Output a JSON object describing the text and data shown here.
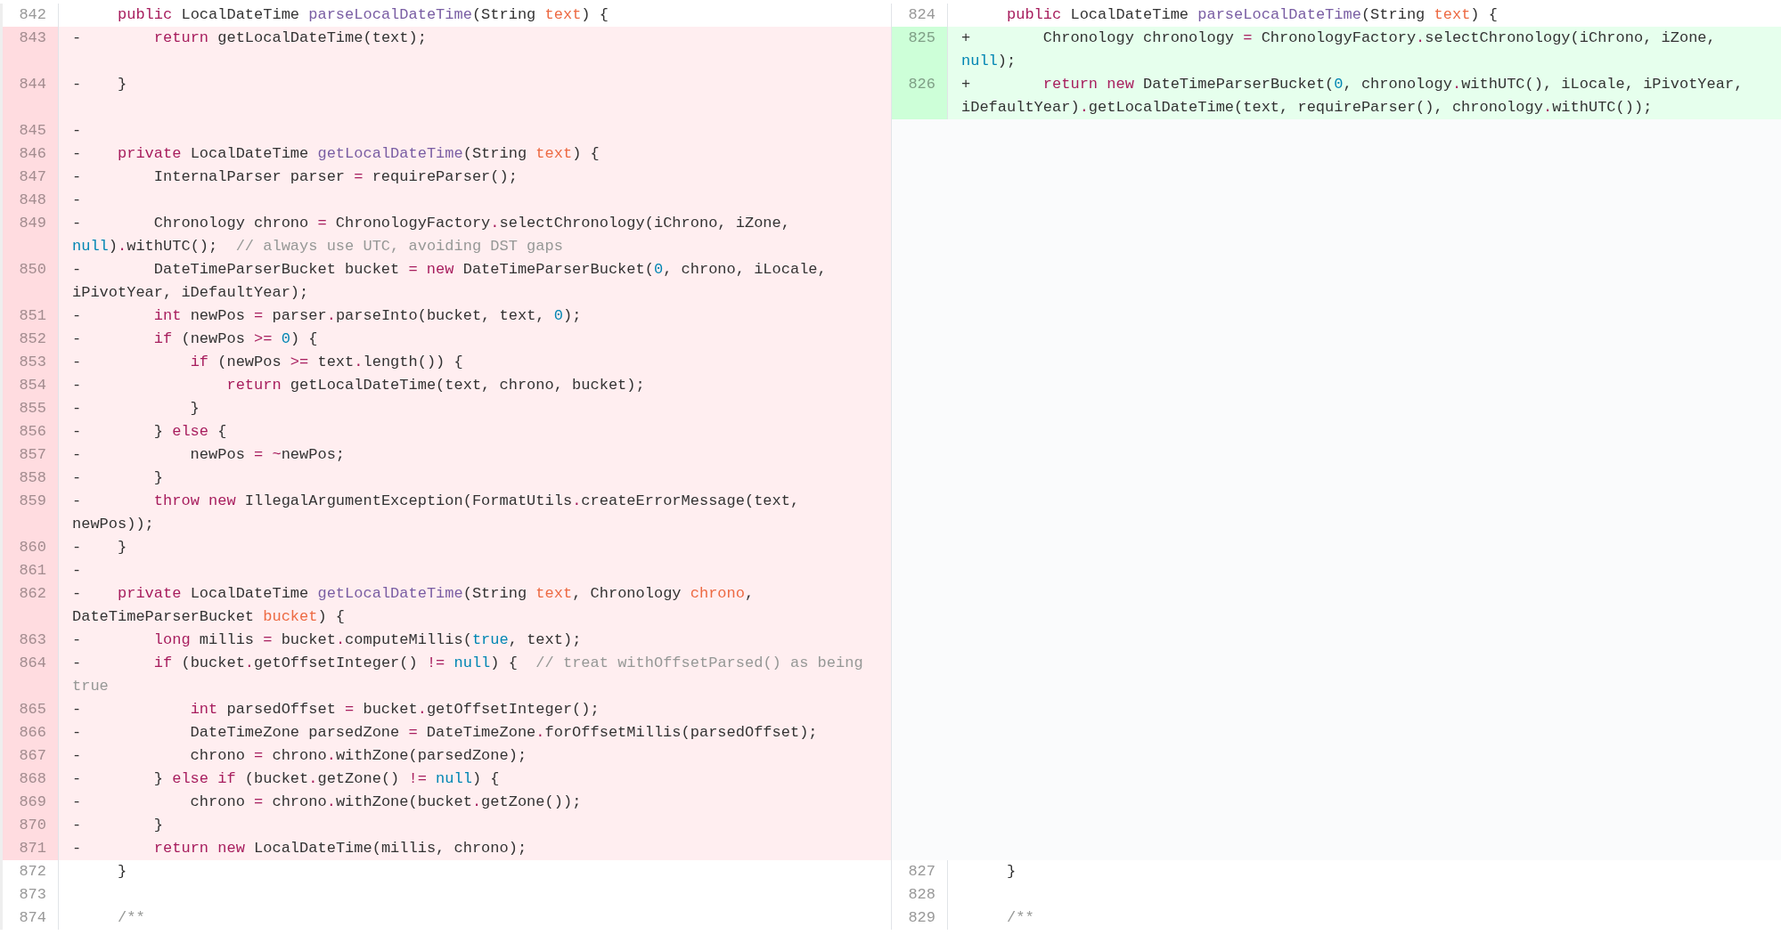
{
  "diff": {
    "rows": [
      {
        "left": {
          "kind": "context",
          "number": "842",
          "segments": [
            {
              "text": "     public",
              "kind": "keyword"
            },
            {
              "text": " LocalDateTime ",
              "kind": "plain"
            },
            {
              "text": "parseLocalDateTime",
              "kind": "function"
            },
            {
              "text": "(String ",
              "kind": "plain"
            },
            {
              "text": "text",
              "kind": "param"
            },
            {
              "text": ") {",
              "kind": "plain"
            }
          ]
        },
        "right": {
          "kind": "context",
          "number": "824",
          "segments": [
            {
              "text": "     public",
              "kind": "keyword"
            },
            {
              "text": " LocalDateTime ",
              "kind": "plain"
            },
            {
              "text": "parseLocalDateTime",
              "kind": "function"
            },
            {
              "text": "(String ",
              "kind": "plain"
            },
            {
              "text": "text",
              "kind": "param"
            },
            {
              "text": ") {",
              "kind": "plain"
            }
          ]
        }
      },
      {
        "left": {
          "kind": "deleted",
          "number": "843",
          "segments": [
            {
              "text": "-        ",
              "kind": "plain"
            },
            {
              "text": "return",
              "kind": "keyword"
            },
            {
              "text": " getLocalDateTime(text);",
              "kind": "plain"
            }
          ]
        },
        "right": {
          "kind": "added",
          "number": "825",
          "segments": [
            {
              "text": "+        Chronology chronology ",
              "kind": "plain"
            },
            {
              "text": "=",
              "kind": "keyword"
            },
            {
              "text": " ChronologyFactory",
              "kind": "plain"
            },
            {
              "text": ".",
              "kind": "keyword"
            },
            {
              "text": "selectChronology(iChrono, iZone, ",
              "kind": "plain"
            },
            {
              "text": "null",
              "kind": "constant"
            },
            {
              "text": ");",
              "kind": "plain"
            }
          ]
        }
      },
      {
        "left": {
          "kind": "deleted",
          "number": "844",
          "segments": [
            {
              "text": "-    }",
              "kind": "plain"
            }
          ]
        },
        "right": {
          "kind": "added",
          "number": "826",
          "segments": [
            {
              "text": "+        ",
              "kind": "plain"
            },
            {
              "text": "return",
              "kind": "keyword"
            },
            {
              "text": " new",
              "kind": "keyword"
            },
            {
              "text": " DateTimeParserBucket(",
              "kind": "plain"
            },
            {
              "text": "0",
              "kind": "constant"
            },
            {
              "text": ", chronology",
              "kind": "plain"
            },
            {
              "text": ".",
              "kind": "keyword"
            },
            {
              "text": "withUTC(), iLocale, iPivotYear, iDefaultYear)",
              "kind": "plain"
            },
            {
              "text": ".",
              "kind": "keyword"
            },
            {
              "text": "getLocalDateTime(text, requireParser(), chronology",
              "kind": "plain"
            },
            {
              "text": ".",
              "kind": "keyword"
            },
            {
              "text": "withUTC());",
              "kind": "plain"
            }
          ]
        }
      },
      {
        "left": {
          "kind": "deleted",
          "number": "845",
          "segments": [
            {
              "text": "-",
              "kind": "plain"
            }
          ]
        },
        "right": {
          "kind": "empty"
        }
      },
      {
        "left": {
          "kind": "deleted",
          "number": "846",
          "segments": [
            {
              "text": "-    ",
              "kind": "plain"
            },
            {
              "text": "private",
              "kind": "keyword"
            },
            {
              "text": " LocalDateTime ",
              "kind": "plain"
            },
            {
              "text": "getLocalDateTime",
              "kind": "function"
            },
            {
              "text": "(String ",
              "kind": "plain"
            },
            {
              "text": "text",
              "kind": "param"
            },
            {
              "text": ") {",
              "kind": "plain"
            }
          ]
        },
        "right": {
          "kind": "empty"
        }
      },
      {
        "left": {
          "kind": "deleted",
          "number": "847",
          "segments": [
            {
              "text": "-        InternalParser parser ",
              "kind": "plain"
            },
            {
              "text": "=",
              "kind": "keyword"
            },
            {
              "text": " requireParser();",
              "kind": "plain"
            }
          ]
        },
        "right": {
          "kind": "empty"
        }
      },
      {
        "left": {
          "kind": "deleted",
          "number": "848",
          "segments": [
            {
              "text": "-",
              "kind": "plain"
            }
          ]
        },
        "right": {
          "kind": "empty"
        }
      },
      {
        "left": {
          "kind": "deleted",
          "number": "849",
          "segments": [
            {
              "text": "-        Chronology chrono ",
              "kind": "plain"
            },
            {
              "text": "=",
              "kind": "keyword"
            },
            {
              "text": " ChronologyFactory",
              "kind": "plain"
            },
            {
              "text": ".",
              "kind": "keyword"
            },
            {
              "text": "selectChronology(iChrono, iZone, ",
              "kind": "plain"
            },
            {
              "text": "null",
              "kind": "constant"
            },
            {
              "text": ")",
              "kind": "plain"
            },
            {
              "text": ".",
              "kind": "keyword"
            },
            {
              "text": "withUTC();  ",
              "kind": "plain"
            },
            {
              "text": "// always use UTC, avoiding DST gaps",
              "kind": "comment"
            }
          ]
        },
        "right": {
          "kind": "empty"
        }
      },
      {
        "left": {
          "kind": "deleted",
          "number": "850",
          "segments": [
            {
              "text": "-        DateTimeParserBucket bucket ",
              "kind": "plain"
            },
            {
              "text": "=",
              "kind": "keyword"
            },
            {
              "text": " new",
              "kind": "keyword"
            },
            {
              "text": " DateTimeParserBucket(",
              "kind": "plain"
            },
            {
              "text": "0",
              "kind": "constant"
            },
            {
              "text": ", chrono, iLocale, iPivotYear, iDefaultYear);",
              "kind": "plain"
            }
          ]
        },
        "right": {
          "kind": "empty"
        }
      },
      {
        "left": {
          "kind": "deleted",
          "number": "851",
          "segments": [
            {
              "text": "-        ",
              "kind": "plain"
            },
            {
              "text": "int",
              "kind": "keyword"
            },
            {
              "text": " newPos ",
              "kind": "plain"
            },
            {
              "text": "=",
              "kind": "keyword"
            },
            {
              "text": " parser",
              "kind": "plain"
            },
            {
              "text": ".",
              "kind": "keyword"
            },
            {
              "text": "parseInto(bucket, text, ",
              "kind": "plain"
            },
            {
              "text": "0",
              "kind": "constant"
            },
            {
              "text": ");",
              "kind": "plain"
            }
          ]
        },
        "right": {
          "kind": "empty"
        }
      },
      {
        "left": {
          "kind": "deleted",
          "number": "852",
          "segments": [
            {
              "text": "-        ",
              "kind": "plain"
            },
            {
              "text": "if",
              "kind": "keyword"
            },
            {
              "text": " (newPos ",
              "kind": "plain"
            },
            {
              "text": ">=",
              "kind": "keyword"
            },
            {
              "text": " 0",
              "kind": "constant"
            },
            {
              "text": ") {",
              "kind": "plain"
            }
          ]
        },
        "right": {
          "kind": "empty"
        }
      },
      {
        "left": {
          "kind": "deleted",
          "number": "853",
          "segments": [
            {
              "text": "-            ",
              "kind": "plain"
            },
            {
              "text": "if",
              "kind": "keyword"
            },
            {
              "text": " (newPos ",
              "kind": "plain"
            },
            {
              "text": ">=",
              "kind": "keyword"
            },
            {
              "text": " text",
              "kind": "plain"
            },
            {
              "text": ".",
              "kind": "keyword"
            },
            {
              "text": "length()) {",
              "kind": "plain"
            }
          ]
        },
        "right": {
          "kind": "empty"
        }
      },
      {
        "left": {
          "kind": "deleted",
          "number": "854",
          "segments": [
            {
              "text": "-                ",
              "kind": "plain"
            },
            {
              "text": "return",
              "kind": "keyword"
            },
            {
              "text": " getLocalDateTime(text, chrono, bucket);",
              "kind": "plain"
            }
          ]
        },
        "right": {
          "kind": "empty"
        }
      },
      {
        "left": {
          "kind": "deleted",
          "number": "855",
          "segments": [
            {
              "text": "-            }",
              "kind": "plain"
            }
          ]
        },
        "right": {
          "kind": "empty"
        }
      },
      {
        "left": {
          "kind": "deleted",
          "number": "856",
          "segments": [
            {
              "text": "-        } ",
              "kind": "plain"
            },
            {
              "text": "else",
              "kind": "keyword"
            },
            {
              "text": " {",
              "kind": "plain"
            }
          ]
        },
        "right": {
          "kind": "empty"
        }
      },
      {
        "left": {
          "kind": "deleted",
          "number": "857",
          "segments": [
            {
              "text": "-            newPos ",
              "kind": "plain"
            },
            {
              "text": "=",
              "kind": "keyword"
            },
            {
              "text": " ~",
              "kind": "keyword"
            },
            {
              "text": "newPos;",
              "kind": "plain"
            }
          ]
        },
        "right": {
          "kind": "empty"
        }
      },
      {
        "left": {
          "kind": "deleted",
          "number": "858",
          "segments": [
            {
              "text": "-        }",
              "kind": "plain"
            }
          ]
        },
        "right": {
          "kind": "empty"
        }
      },
      {
        "left": {
          "kind": "deleted",
          "number": "859",
          "segments": [
            {
              "text": "-        ",
              "kind": "plain"
            },
            {
              "text": "throw",
              "kind": "keyword"
            },
            {
              "text": " new",
              "kind": "keyword"
            },
            {
              "text": " IllegalArgumentException(FormatUtils",
              "kind": "plain"
            },
            {
              "text": ".",
              "kind": "keyword"
            },
            {
              "text": "createErrorMessage(text, newPos));",
              "kind": "plain"
            }
          ]
        },
        "right": {
          "kind": "empty"
        }
      },
      {
        "left": {
          "kind": "deleted",
          "number": "860",
          "segments": [
            {
              "text": "-    }",
              "kind": "plain"
            }
          ]
        },
        "right": {
          "kind": "empty"
        }
      },
      {
        "left": {
          "kind": "deleted",
          "number": "861",
          "segments": [
            {
              "text": "-",
              "kind": "plain"
            }
          ]
        },
        "right": {
          "kind": "empty"
        }
      },
      {
        "left": {
          "kind": "deleted",
          "number": "862",
          "segments": [
            {
              "text": "-    ",
              "kind": "plain"
            },
            {
              "text": "private",
              "kind": "keyword"
            },
            {
              "text": " LocalDateTime ",
              "kind": "plain"
            },
            {
              "text": "getLocalDateTime",
              "kind": "function"
            },
            {
              "text": "(String ",
              "kind": "plain"
            },
            {
              "text": "text",
              "kind": "param"
            },
            {
              "text": ", Chronology ",
              "kind": "plain"
            },
            {
              "text": "chrono",
              "kind": "param"
            },
            {
              "text": ", DateTimeParserBucket ",
              "kind": "plain"
            },
            {
              "text": "bucket",
              "kind": "param"
            },
            {
              "text": ") {",
              "kind": "plain"
            }
          ]
        },
        "right": {
          "kind": "empty"
        }
      },
      {
        "left": {
          "kind": "deleted",
          "number": "863",
          "segments": [
            {
              "text": "-        ",
              "kind": "plain"
            },
            {
              "text": "long",
              "kind": "keyword"
            },
            {
              "text": " millis ",
              "kind": "plain"
            },
            {
              "text": "=",
              "kind": "keyword"
            },
            {
              "text": " bucket",
              "kind": "plain"
            },
            {
              "text": ".",
              "kind": "keyword"
            },
            {
              "text": "computeMillis(",
              "kind": "plain"
            },
            {
              "text": "true",
              "kind": "constant"
            },
            {
              "text": ", text);",
              "kind": "plain"
            }
          ]
        },
        "right": {
          "kind": "empty"
        }
      },
      {
        "left": {
          "kind": "deleted",
          "number": "864",
          "segments": [
            {
              "text": "-        ",
              "kind": "plain"
            },
            {
              "text": "if",
              "kind": "keyword"
            },
            {
              "text": " (bucket",
              "kind": "plain"
            },
            {
              "text": ".",
              "kind": "keyword"
            },
            {
              "text": "getOffsetInteger() ",
              "kind": "plain"
            },
            {
              "text": "!=",
              "kind": "keyword"
            },
            {
              "text": " null",
              "kind": "constant"
            },
            {
              "text": ") {  ",
              "kind": "plain"
            },
            {
              "text": "// treat withOffsetParsed() as being true",
              "kind": "comment"
            }
          ]
        },
        "right": {
          "kind": "empty"
        }
      },
      {
        "left": {
          "kind": "deleted",
          "number": "865",
          "segments": [
            {
              "text": "-            ",
              "kind": "plain"
            },
            {
              "text": "int",
              "kind": "keyword"
            },
            {
              "text": " parsedOffset ",
              "kind": "plain"
            },
            {
              "text": "=",
              "kind": "keyword"
            },
            {
              "text": " bucket",
              "kind": "plain"
            },
            {
              "text": ".",
              "kind": "keyword"
            },
            {
              "text": "getOffsetInteger();",
              "kind": "plain"
            }
          ]
        },
        "right": {
          "kind": "empty"
        }
      },
      {
        "left": {
          "kind": "deleted",
          "number": "866",
          "segments": [
            {
              "text": "-            DateTimeZone parsedZone ",
              "kind": "plain"
            },
            {
              "text": "=",
              "kind": "keyword"
            },
            {
              "text": " DateTimeZone",
              "kind": "plain"
            },
            {
              "text": ".",
              "kind": "keyword"
            },
            {
              "text": "forOffsetMillis(parsedOffset);",
              "kind": "plain"
            }
          ]
        },
        "right": {
          "kind": "empty"
        }
      },
      {
        "left": {
          "kind": "deleted",
          "number": "867",
          "segments": [
            {
              "text": "-            chrono ",
              "kind": "plain"
            },
            {
              "text": "=",
              "kind": "keyword"
            },
            {
              "text": " chrono",
              "kind": "plain"
            },
            {
              "text": ".",
              "kind": "keyword"
            },
            {
              "text": "withZone(parsedZone);",
              "kind": "plain"
            }
          ]
        },
        "right": {
          "kind": "empty"
        }
      },
      {
        "left": {
          "kind": "deleted",
          "number": "868",
          "segments": [
            {
              "text": "-        } ",
              "kind": "plain"
            },
            {
              "text": "else",
              "kind": "keyword"
            },
            {
              "text": " if",
              "kind": "keyword"
            },
            {
              "text": " (bucket",
              "kind": "plain"
            },
            {
              "text": ".",
              "kind": "keyword"
            },
            {
              "text": "getZone() ",
              "kind": "plain"
            },
            {
              "text": "!=",
              "kind": "keyword"
            },
            {
              "text": " null",
              "kind": "constant"
            },
            {
              "text": ") {",
              "kind": "plain"
            }
          ]
        },
        "right": {
          "kind": "empty"
        }
      },
      {
        "left": {
          "kind": "deleted",
          "number": "869",
          "segments": [
            {
              "text": "-            chrono ",
              "kind": "plain"
            },
            {
              "text": "=",
              "kind": "keyword"
            },
            {
              "text": " chrono",
              "kind": "plain"
            },
            {
              "text": ".",
              "kind": "keyword"
            },
            {
              "text": "withZone(bucket",
              "kind": "plain"
            },
            {
              "text": ".",
              "kind": "keyword"
            },
            {
              "text": "getZone());",
              "kind": "plain"
            }
          ]
        },
        "right": {
          "kind": "empty"
        }
      },
      {
        "left": {
          "kind": "deleted",
          "number": "870",
          "segments": [
            {
              "text": "-        }",
              "kind": "plain"
            }
          ]
        },
        "right": {
          "kind": "empty"
        }
      },
      {
        "left": {
          "kind": "deleted",
          "number": "871",
          "segments": [
            {
              "text": "-        ",
              "kind": "plain"
            },
            {
              "text": "return",
              "kind": "keyword"
            },
            {
              "text": " new",
              "kind": "keyword"
            },
            {
              "text": " LocalDateTime(millis, chrono);",
              "kind": "plain"
            }
          ]
        },
        "right": {
          "kind": "empty"
        }
      },
      {
        "left": {
          "kind": "context",
          "number": "872",
          "segments": [
            {
              "text": "     }",
              "kind": "plain"
            }
          ]
        },
        "right": {
          "kind": "context",
          "number": "827",
          "segments": [
            {
              "text": "     }",
              "kind": "plain"
            }
          ]
        }
      },
      {
        "left": {
          "kind": "context",
          "number": "873"
        },
        "right": {
          "kind": "context",
          "number": "828"
        }
      },
      {
        "left": {
          "kind": "context",
          "number": "874",
          "segments": [
            {
              "text": "     /**",
              "kind": "comment"
            }
          ]
        },
        "right": {
          "kind": "context",
          "number": "829",
          "segments": [
            {
              "text": "     /**",
              "kind": "comment"
            }
          ]
        }
      }
    ]
  }
}
